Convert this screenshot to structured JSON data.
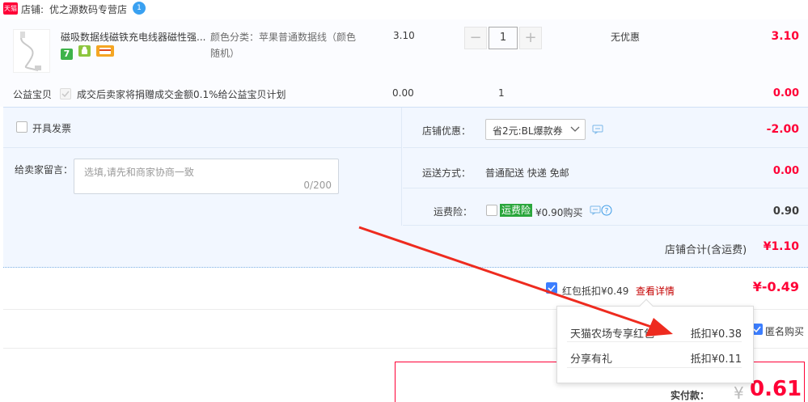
{
  "shop": {
    "tmall_badge": "天猫",
    "prefix": "店铺:",
    "name": "优之源数码专营店",
    "chat_badge": "1"
  },
  "product": {
    "title": "磁吸数据线磁铁充电线器磁性强...",
    "sku_line1": "颜色分类：苹果普通数据线（颜色",
    "sku_line2": "随机）",
    "unit_price": "3.10",
    "quantity": "1",
    "minus": "−",
    "plus": "+",
    "discount": "无优惠",
    "subtotal": "3.10",
    "service_icons": [
      "seven-day-return-icon",
      "android-icon",
      "card-payment-icon"
    ],
    "service_icon_seven": "7"
  },
  "charity": {
    "label": "公益宝贝",
    "text": "成交后卖家将捐赠成交金额0.1%给公益宝贝计划",
    "price": "0.00",
    "qty": "1",
    "total": "0.00"
  },
  "invoice": {
    "label": "开具发票"
  },
  "message": {
    "label": "给卖家留言：",
    "placeholder": "选填,请先和商家协商一致",
    "counter": "0/200"
  },
  "shop_discount": {
    "label": "店铺优惠：",
    "selected": "省2元:BL爆款券",
    "amount": "-2.00"
  },
  "shipping": {
    "label": "运送方式：",
    "value": "普通配送 快递 免邮",
    "amount": "0.00"
  },
  "insurance": {
    "label": "运费险：",
    "badge": "运费险",
    "text": "¥0.90购买",
    "amount": "0.90"
  },
  "store_total": {
    "label": "店铺合计(含运费)",
    "amount": "¥1.10"
  },
  "red_packet": {
    "label": "红包抵扣¥0.49",
    "details_link": "查看详情",
    "amount": "¥-0.49"
  },
  "popup": {
    "rows": [
      {
        "name": "天猫农场专享红包",
        "value": "抵扣¥0.38"
      },
      {
        "name": "分享有礼",
        "value": "抵扣¥0.11"
      }
    ]
  },
  "anonymous": {
    "label": "匿名购买"
  },
  "payment": {
    "label": "实付款：",
    "currency": "¥",
    "amount": "0.61"
  },
  "colors": {
    "accent_red": "#ff0036",
    "panel_blue": "#f2f7ff",
    "checkbox_blue": "#3c7eff",
    "arrow_red": "#ee2b1f",
    "insurance_green": "#2aa63c"
  }
}
